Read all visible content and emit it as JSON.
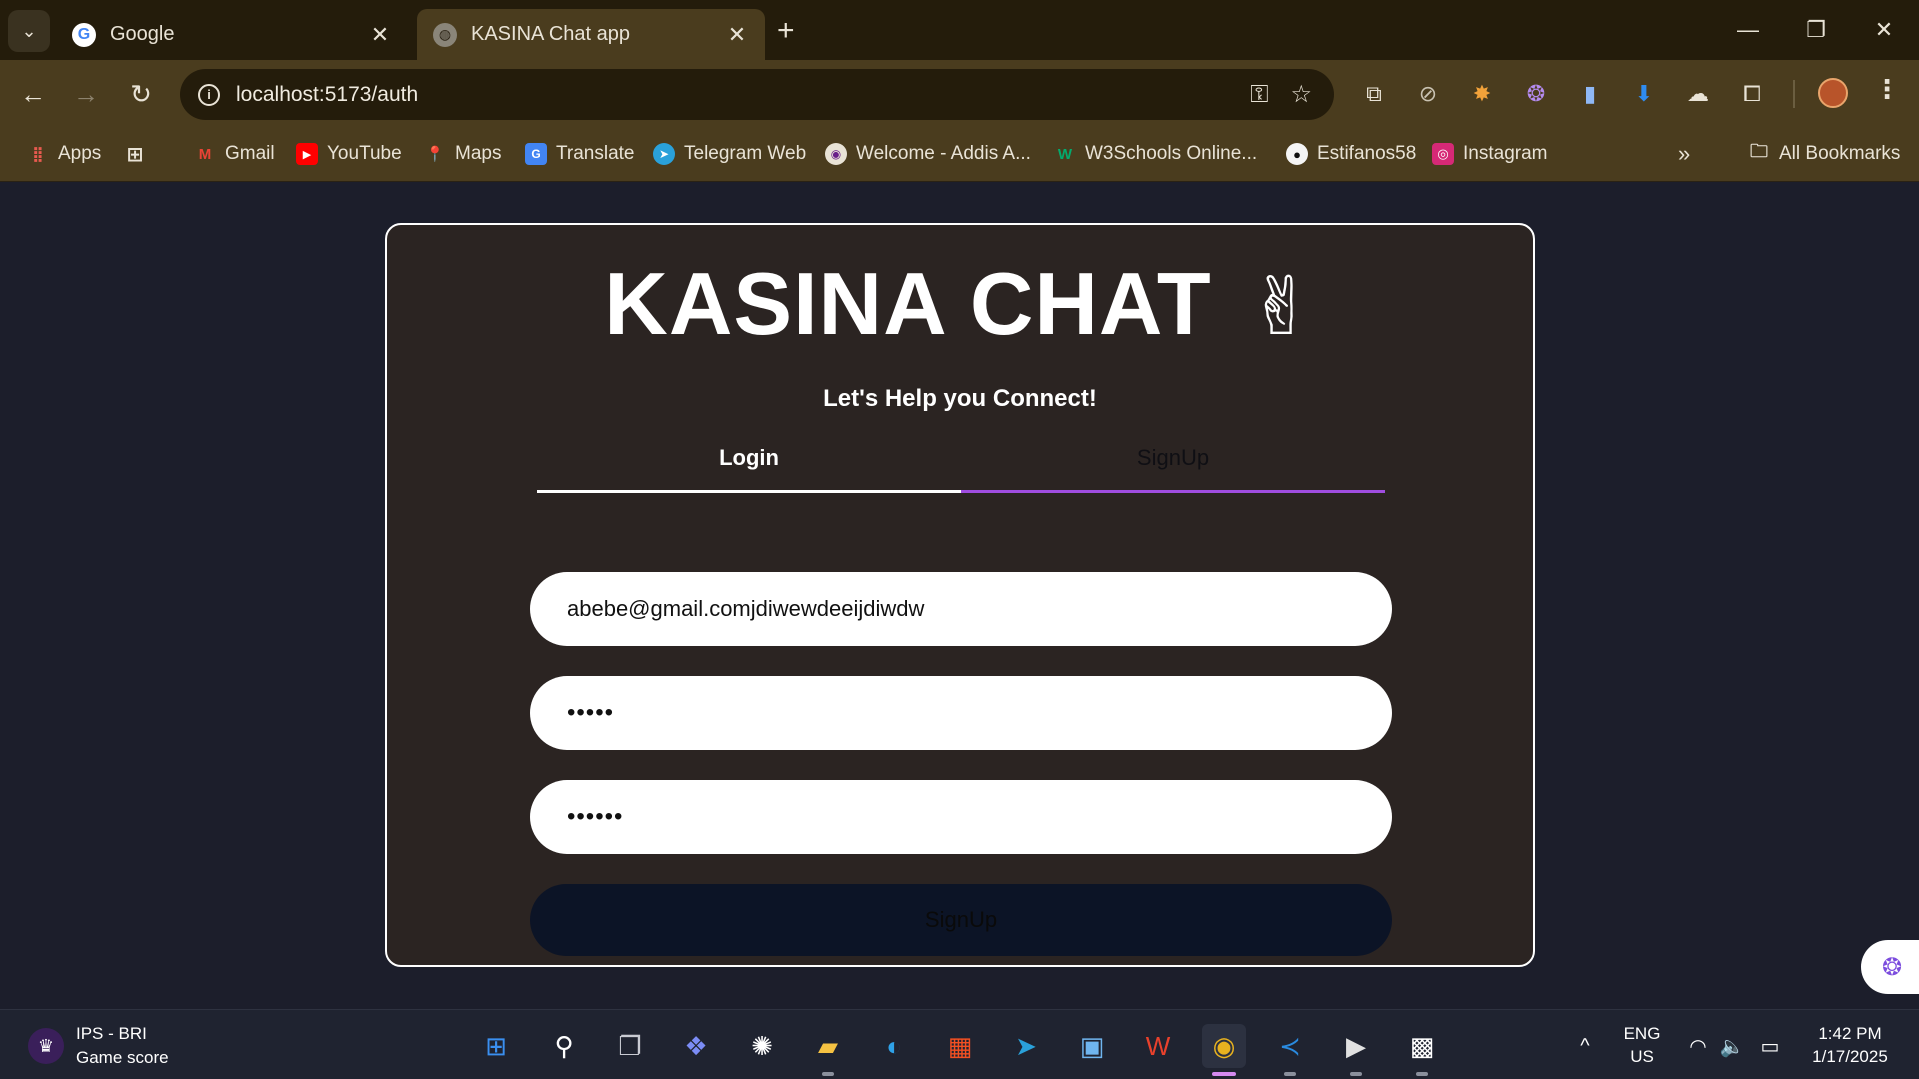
{
  "browser": {
    "tabs": [
      {
        "title": "Google",
        "favicon": "google-icon",
        "active": false
      },
      {
        "title": "KASINA Chat app",
        "favicon": "globe-icon",
        "active": true
      }
    ],
    "url": "localhost:5173/auth",
    "bookmarks": [
      {
        "label": "Apps",
        "icon": "apps-grid-icon"
      },
      {
        "label": "Gmail",
        "icon": "gmail-icon"
      },
      {
        "label": "YouTube",
        "icon": "youtube-icon"
      },
      {
        "label": "Maps",
        "icon": "maps-icon"
      },
      {
        "label": "Translate",
        "icon": "translate-icon"
      },
      {
        "label": "Telegram Web",
        "icon": "telegram-icon"
      },
      {
        "label": "Welcome - Addis A...",
        "icon": "addis-icon"
      },
      {
        "label": "W3Schools Online...",
        "icon": "w3schools-icon"
      },
      {
        "label": "Estifanos58",
        "icon": "github-icon"
      },
      {
        "label": "Instagram",
        "icon": "instagram-icon"
      }
    ],
    "all_bookmarks_label": "All Bookmarks"
  },
  "app": {
    "brand": "KASINA CHAT",
    "brand_emoji": "✌",
    "subtitle": "Let's Help you Connect!",
    "tab_login": "Login",
    "tab_signup": "SignUp",
    "email_value": "abebe@gmail.comjdiwewdeeijdiwdw",
    "password_value": "•••••",
    "confirm_password_value": "••••••",
    "submit_label": "SignUp"
  },
  "taskbar": {
    "widget_title": "IPS - BRI",
    "widget_subtitle": "Game score",
    "lang_top": "ENG",
    "lang_bottom": "US",
    "time": "1:42 PM",
    "date": "1/17/2025"
  },
  "colors": {
    "chrome_dark": "#241c0b",
    "chrome_light": "#4a3c1e",
    "page_bg": "#1c1e2b",
    "card_bg": "#2b2422",
    "signup_accent": "#a04de0",
    "submit_bg": "#0c1426"
  }
}
